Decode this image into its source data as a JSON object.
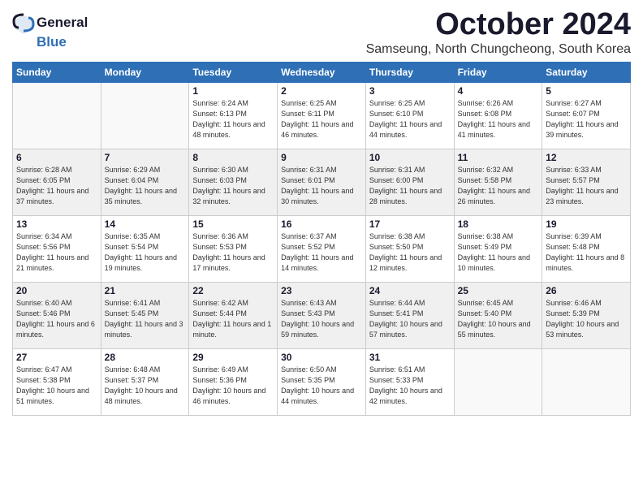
{
  "logo": {
    "general": "General",
    "blue": "Blue"
  },
  "title": "October 2024",
  "subtitle": "Samseung, North Chungcheong, South Korea",
  "days_of_week": [
    "Sunday",
    "Monday",
    "Tuesday",
    "Wednesday",
    "Thursday",
    "Friday",
    "Saturday"
  ],
  "weeks": [
    [
      {
        "day": "",
        "info": ""
      },
      {
        "day": "",
        "info": ""
      },
      {
        "day": "1",
        "info": "Sunrise: 6:24 AM\nSunset: 6:13 PM\nDaylight: 11 hours and 48 minutes."
      },
      {
        "day": "2",
        "info": "Sunrise: 6:25 AM\nSunset: 6:11 PM\nDaylight: 11 hours and 46 minutes."
      },
      {
        "day": "3",
        "info": "Sunrise: 6:25 AM\nSunset: 6:10 PM\nDaylight: 11 hours and 44 minutes."
      },
      {
        "day": "4",
        "info": "Sunrise: 6:26 AM\nSunset: 6:08 PM\nDaylight: 11 hours and 41 minutes."
      },
      {
        "day": "5",
        "info": "Sunrise: 6:27 AM\nSunset: 6:07 PM\nDaylight: 11 hours and 39 minutes."
      }
    ],
    [
      {
        "day": "6",
        "info": "Sunrise: 6:28 AM\nSunset: 6:05 PM\nDaylight: 11 hours and 37 minutes."
      },
      {
        "day": "7",
        "info": "Sunrise: 6:29 AM\nSunset: 6:04 PM\nDaylight: 11 hours and 35 minutes."
      },
      {
        "day": "8",
        "info": "Sunrise: 6:30 AM\nSunset: 6:03 PM\nDaylight: 11 hours and 32 minutes."
      },
      {
        "day": "9",
        "info": "Sunrise: 6:31 AM\nSunset: 6:01 PM\nDaylight: 11 hours and 30 minutes."
      },
      {
        "day": "10",
        "info": "Sunrise: 6:31 AM\nSunset: 6:00 PM\nDaylight: 11 hours and 28 minutes."
      },
      {
        "day": "11",
        "info": "Sunrise: 6:32 AM\nSunset: 5:58 PM\nDaylight: 11 hours and 26 minutes."
      },
      {
        "day": "12",
        "info": "Sunrise: 6:33 AM\nSunset: 5:57 PM\nDaylight: 11 hours and 23 minutes."
      }
    ],
    [
      {
        "day": "13",
        "info": "Sunrise: 6:34 AM\nSunset: 5:56 PM\nDaylight: 11 hours and 21 minutes."
      },
      {
        "day": "14",
        "info": "Sunrise: 6:35 AM\nSunset: 5:54 PM\nDaylight: 11 hours and 19 minutes."
      },
      {
        "day": "15",
        "info": "Sunrise: 6:36 AM\nSunset: 5:53 PM\nDaylight: 11 hours and 17 minutes."
      },
      {
        "day": "16",
        "info": "Sunrise: 6:37 AM\nSunset: 5:52 PM\nDaylight: 11 hours and 14 minutes."
      },
      {
        "day": "17",
        "info": "Sunrise: 6:38 AM\nSunset: 5:50 PM\nDaylight: 11 hours and 12 minutes."
      },
      {
        "day": "18",
        "info": "Sunrise: 6:38 AM\nSunset: 5:49 PM\nDaylight: 11 hours and 10 minutes."
      },
      {
        "day": "19",
        "info": "Sunrise: 6:39 AM\nSunset: 5:48 PM\nDaylight: 11 hours and 8 minutes."
      }
    ],
    [
      {
        "day": "20",
        "info": "Sunrise: 6:40 AM\nSunset: 5:46 PM\nDaylight: 11 hours and 6 minutes."
      },
      {
        "day": "21",
        "info": "Sunrise: 6:41 AM\nSunset: 5:45 PM\nDaylight: 11 hours and 3 minutes."
      },
      {
        "day": "22",
        "info": "Sunrise: 6:42 AM\nSunset: 5:44 PM\nDaylight: 11 hours and 1 minute."
      },
      {
        "day": "23",
        "info": "Sunrise: 6:43 AM\nSunset: 5:43 PM\nDaylight: 10 hours and 59 minutes."
      },
      {
        "day": "24",
        "info": "Sunrise: 6:44 AM\nSunset: 5:41 PM\nDaylight: 10 hours and 57 minutes."
      },
      {
        "day": "25",
        "info": "Sunrise: 6:45 AM\nSunset: 5:40 PM\nDaylight: 10 hours and 55 minutes."
      },
      {
        "day": "26",
        "info": "Sunrise: 6:46 AM\nSunset: 5:39 PM\nDaylight: 10 hours and 53 minutes."
      }
    ],
    [
      {
        "day": "27",
        "info": "Sunrise: 6:47 AM\nSunset: 5:38 PM\nDaylight: 10 hours and 51 minutes."
      },
      {
        "day": "28",
        "info": "Sunrise: 6:48 AM\nSunset: 5:37 PM\nDaylight: 10 hours and 48 minutes."
      },
      {
        "day": "29",
        "info": "Sunrise: 6:49 AM\nSunset: 5:36 PM\nDaylight: 10 hours and 46 minutes."
      },
      {
        "day": "30",
        "info": "Sunrise: 6:50 AM\nSunset: 5:35 PM\nDaylight: 10 hours and 44 minutes."
      },
      {
        "day": "31",
        "info": "Sunrise: 6:51 AM\nSunset: 5:33 PM\nDaylight: 10 hours and 42 minutes."
      },
      {
        "day": "",
        "info": ""
      },
      {
        "day": "",
        "info": ""
      }
    ]
  ]
}
